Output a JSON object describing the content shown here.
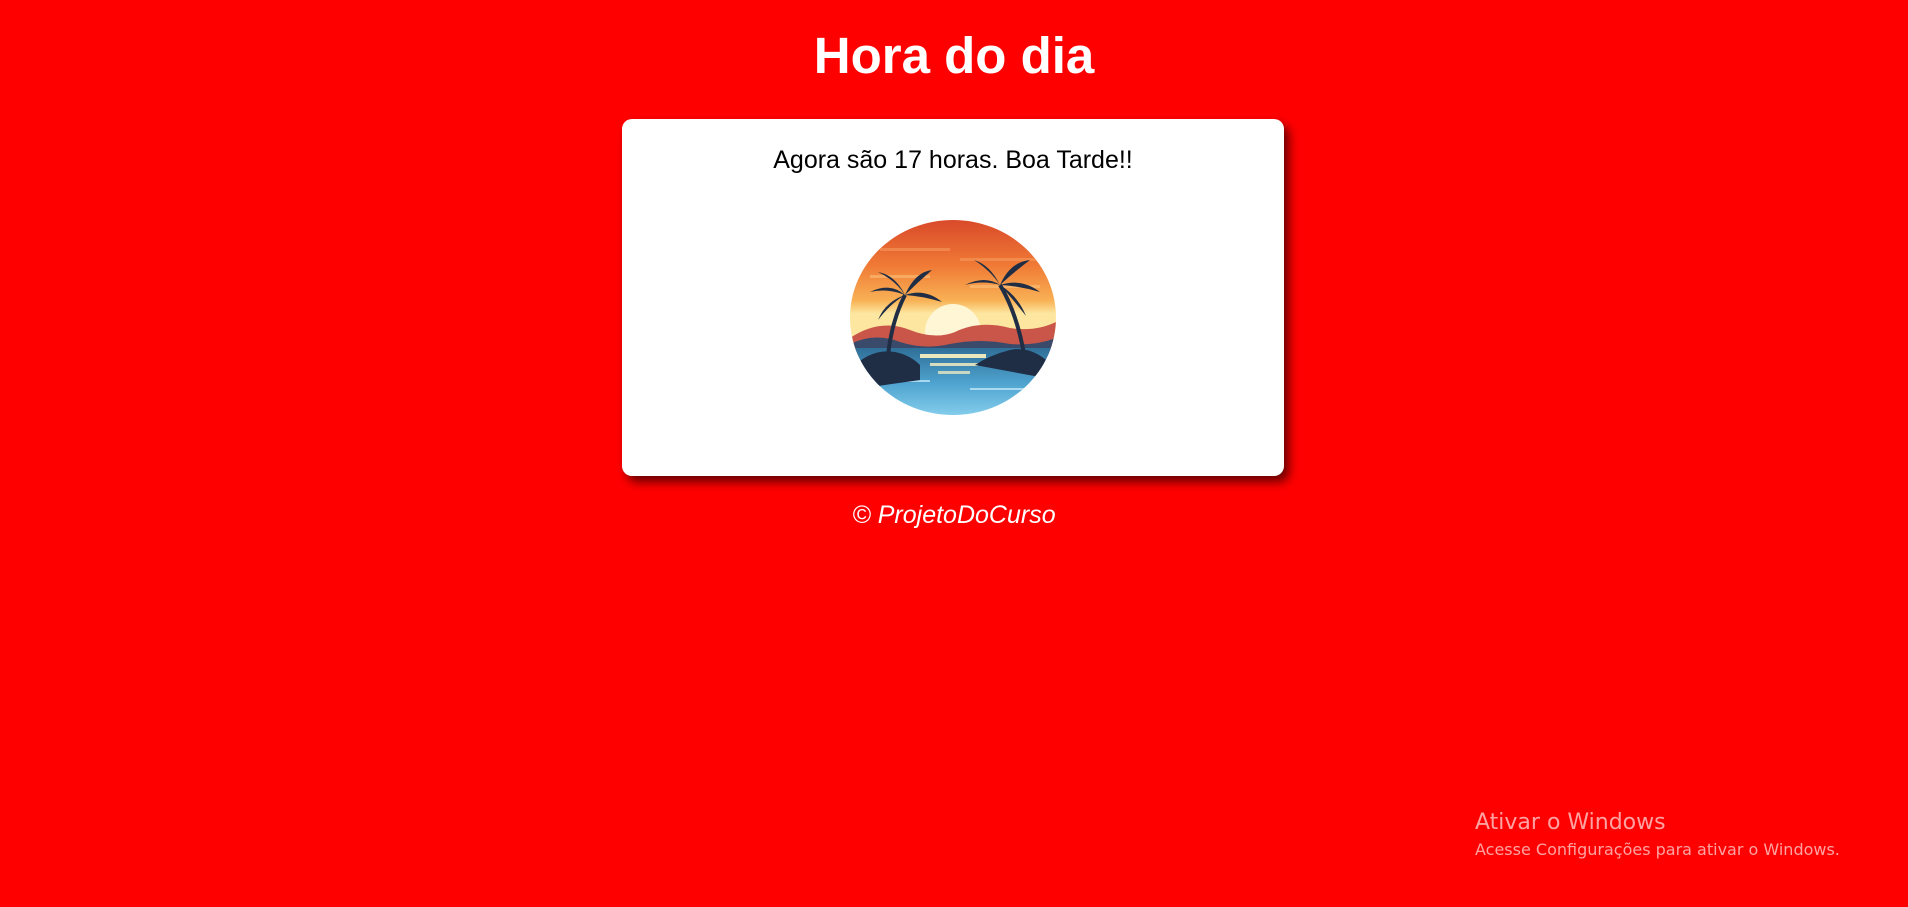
{
  "page": {
    "background_color": "#ff0000",
    "title": "Hora do dia"
  },
  "card": {
    "message": "Agora são 17 horas. Boa Tarde!!",
    "image_icon": "sunset-beach-image"
  },
  "footer": {
    "text": "© ProjetoDoCurso"
  },
  "os_watermark": {
    "title": "Ativar o Windows",
    "subtitle": "Acesse Configurações para ativar o Windows."
  }
}
